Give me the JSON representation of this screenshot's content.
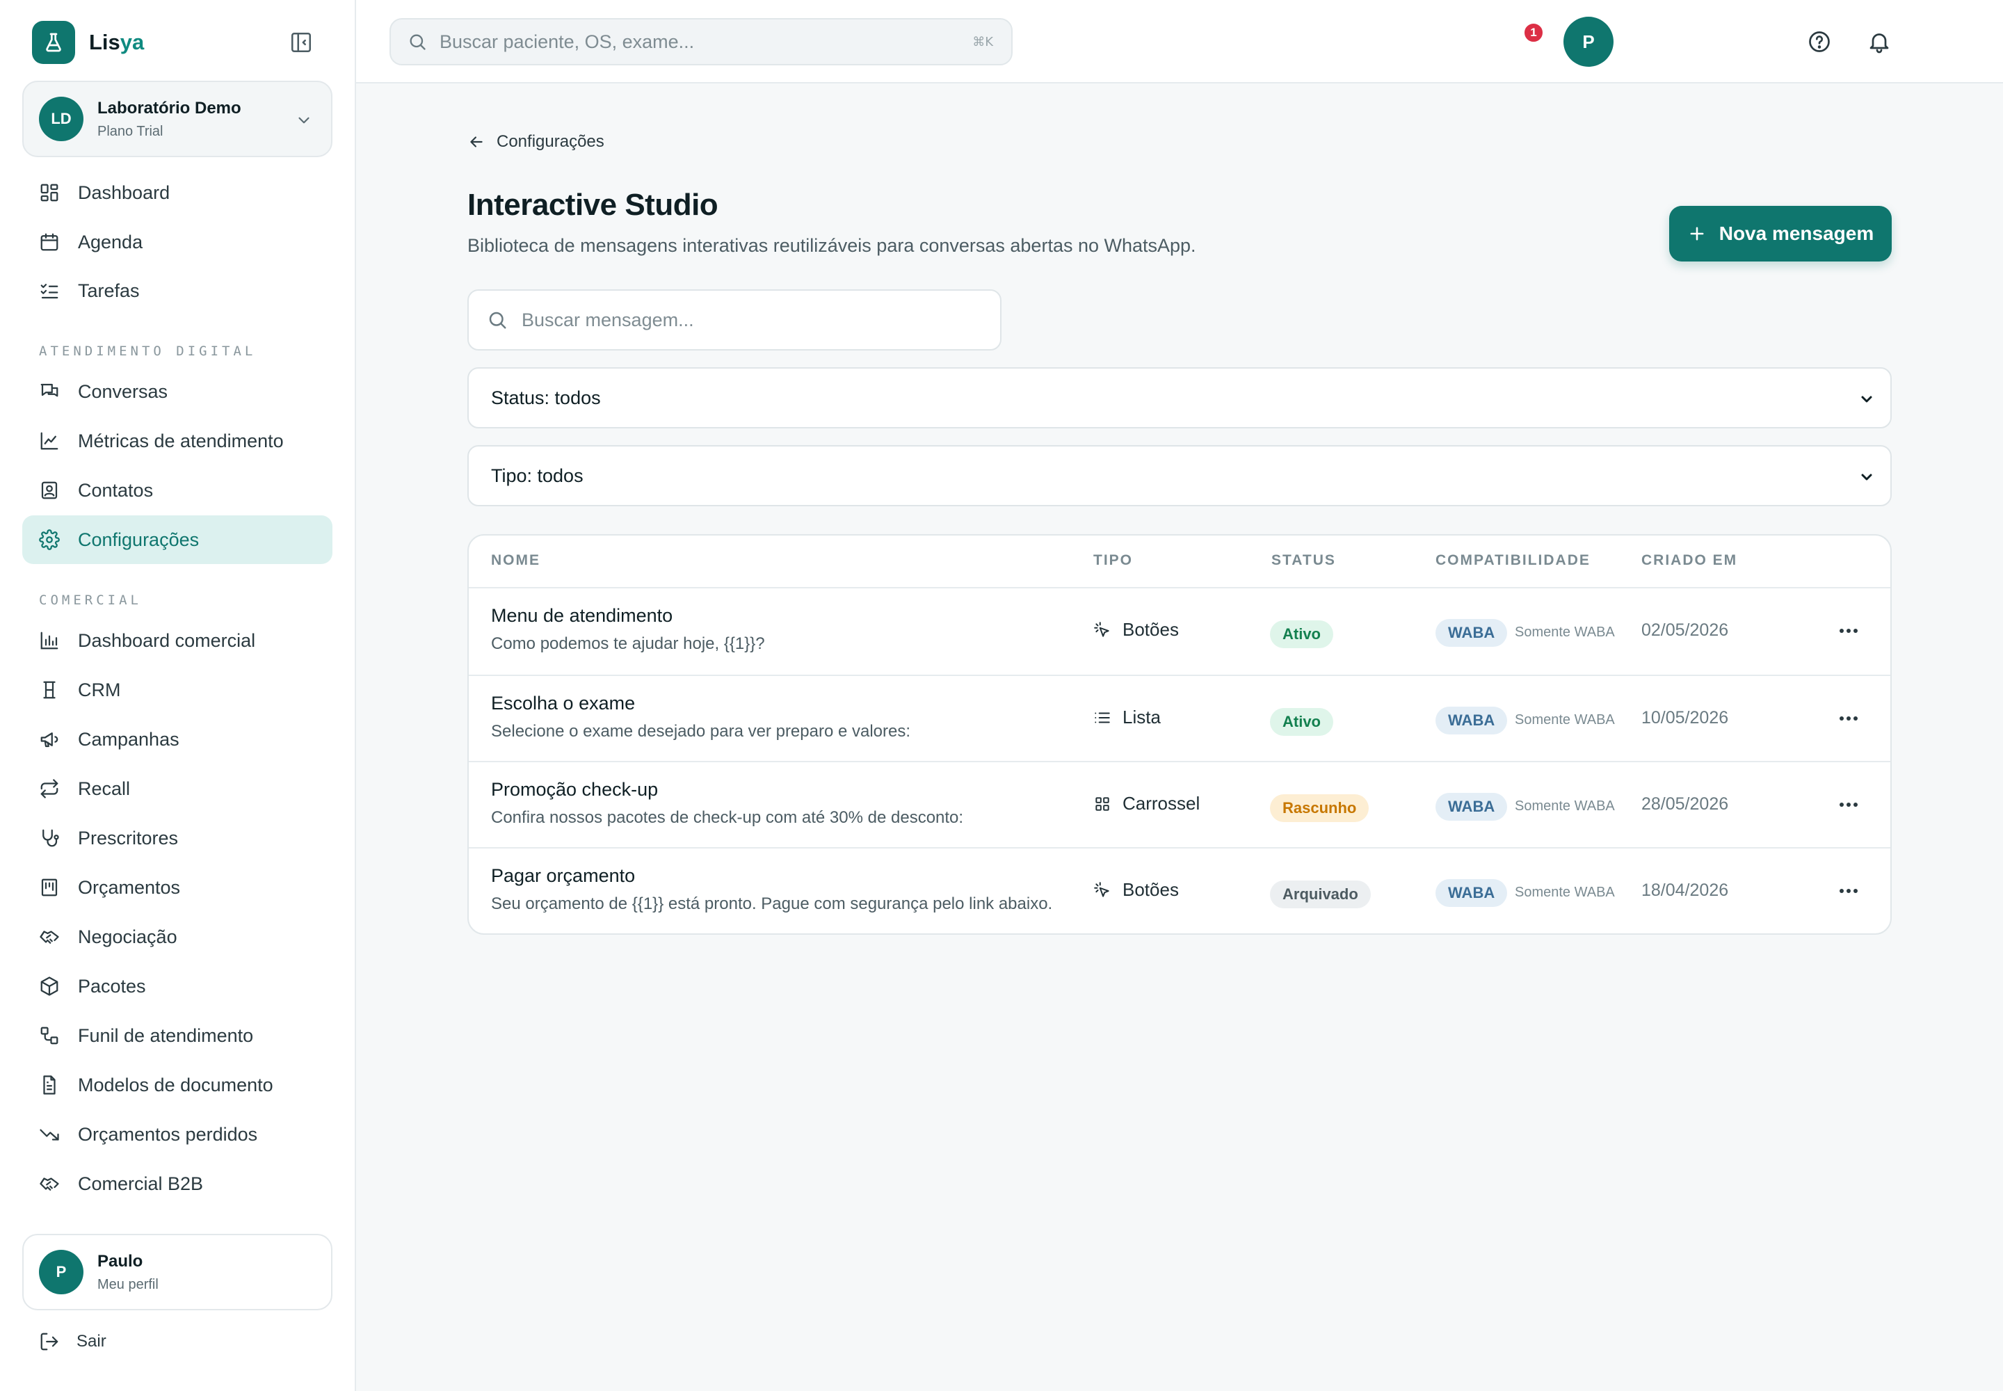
{
  "brand": {
    "name_prefix": "Lis",
    "name_suffix": "ya"
  },
  "org": {
    "initials": "LD",
    "name": "Laboratório Demo",
    "plan": "Plano Trial"
  },
  "nav": {
    "dashboard": "Dashboard",
    "agenda": "Agenda",
    "tarefas": "Tarefas",
    "section_atendimento": "ATENDIMENTO DIGITAL",
    "conversas": "Conversas",
    "metricas": "Métricas de atendimento",
    "contatos": "Contatos",
    "configuracoes": "Configurações",
    "section_comercial": "COMERCIAL",
    "dashboard_comercial": "Dashboard comercial",
    "crm": "CRM",
    "campanhas": "Campanhas",
    "recall": "Recall",
    "prescritores": "Prescritores",
    "orcamentos": "Orçamentos",
    "negociacao": "Negociação",
    "pacotes": "Pacotes",
    "funil": "Funil de atendimento",
    "modelos": "Modelos de documento",
    "orcamentos_perdidos": "Orçamentos perdidos",
    "comercial_b2b": "Comercial B2B"
  },
  "user": {
    "initial": "P",
    "name": "Paulo",
    "sub": "Meu perfil",
    "logout": "Sair"
  },
  "topbar": {
    "search_placeholder": "Buscar paciente, OS, exame...",
    "shortcut": "⌘K",
    "notifications_count": "1",
    "avatar_initial": "P"
  },
  "page": {
    "back_label": "Configurações",
    "title": "Interactive Studio",
    "subtitle": "Biblioteca de mensagens interativas reutilizáveis para conversas abertas no WhatsApp.",
    "new_button": "Nova mensagem",
    "search_placeholder": "Buscar mensagem...",
    "status_filter": "Status: todos",
    "type_filter": "Tipo: todos"
  },
  "table": {
    "headers": [
      "NOME",
      "TIPO",
      "STATUS",
      "COMPATIBILIDADE",
      "CRIADO EM"
    ],
    "rows": [
      {
        "name": "Menu de atendimento",
        "preview": "Como podemos te ajudar hoje, {{1}}?",
        "type": "Botões",
        "type_icon": "cursor-click-icon",
        "status": "Ativo",
        "compat": "WABA",
        "compat_note": "Somente WABA",
        "created": "02/05/2026"
      },
      {
        "name": "Escolha o exame",
        "preview": "Selecione o exame desejado para ver preparo e valores:",
        "type": "Lista",
        "type_icon": "list-icon",
        "status": "Ativo",
        "compat": "WABA",
        "compat_note": "Somente WABA",
        "created": "10/05/2026"
      },
      {
        "name": "Promoção check-up",
        "preview": "Confira nossos pacotes de check-up com até 30% de desconto:",
        "type": "Carrossel",
        "type_icon": "grid-icon",
        "status": "Rascunho",
        "compat": "WABA",
        "compat_note": "Somente WABA",
        "created": "28/05/2026"
      },
      {
        "name": "Pagar orçamento",
        "preview": "Seu orçamento de {{1}} está pronto. Pague com segurança pelo link abaixo.",
        "type": "Botões",
        "type_icon": "cursor-click-icon",
        "status": "Arquivado",
        "compat": "WABA",
        "compat_note": "Somente WABA",
        "created": "18/04/2026"
      }
    ]
  },
  "colors": {
    "primary": "#0f766e",
    "active_bg": "#dcf1ef",
    "badge_red": "#dc2f45"
  }
}
